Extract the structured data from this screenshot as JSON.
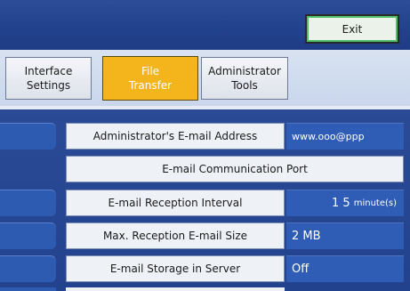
{
  "header": {
    "exit_label": "Exit"
  },
  "tabs": {
    "interface": {
      "line1": "Interface",
      "line2": "Settings"
    },
    "file": {
      "line1": "File",
      "line2": "Transfer"
    },
    "admin": {
      "line1": "Administrator",
      "line2": "Tools"
    }
  },
  "settings": [
    {
      "label": "Administrator's E-mail Address",
      "value": "www.ooo@ppp"
    },
    {
      "label": "E-mail Communication Port"
    },
    {
      "label": "E-mail Reception Interval",
      "value": "1 5",
      "unit": "minute(s)"
    },
    {
      "label": "Max. Reception E-mail Size",
      "value": "2 MB"
    },
    {
      "label": "E-mail Storage in Server",
      "value": "Off"
    }
  ],
  "colors": {
    "header_blue": "#22418c",
    "selected_tab": "#f3b51b",
    "value_blue": "#2f5cb4",
    "exit_border": "#4fc06a"
  }
}
